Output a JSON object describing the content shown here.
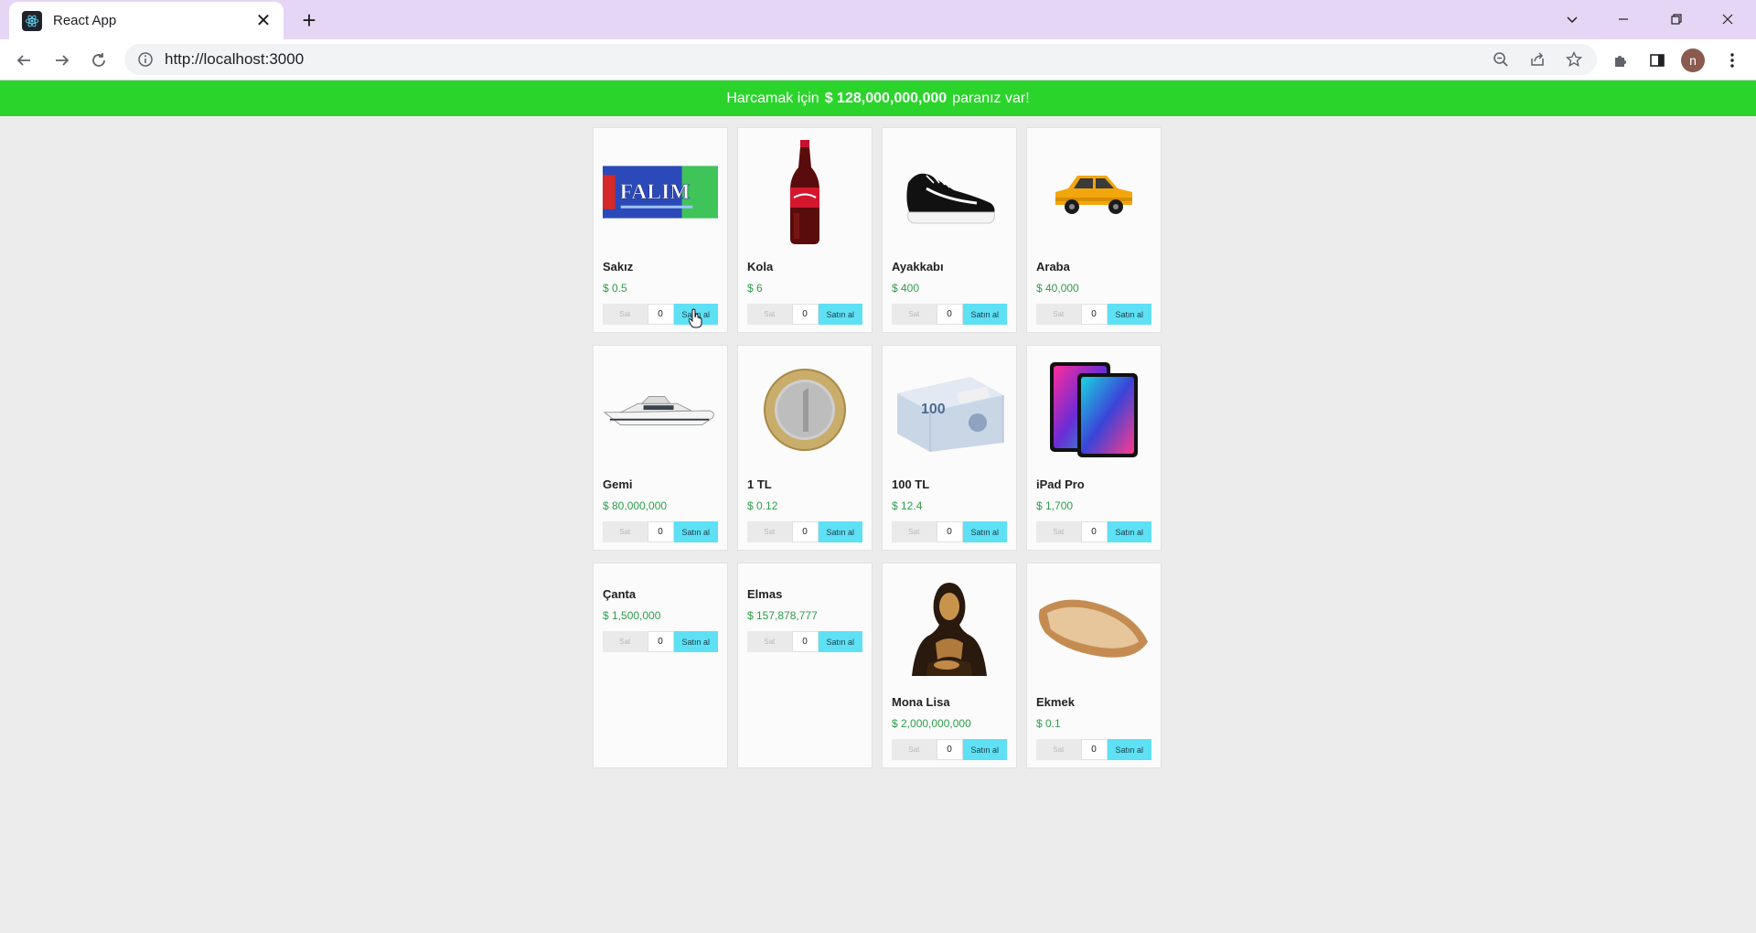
{
  "browser": {
    "tab_title": "React App",
    "url": "http://localhost:3000",
    "profile_initial": "n"
  },
  "banner": {
    "prefix": "Harcamak için",
    "amount": "$ 128,000,000,000",
    "suffix": "paranız var!"
  },
  "products": [
    {
      "name": "Sakız",
      "price": "$ 0.5",
      "icon": "gum-image",
      "sell_label": "Sat",
      "qty": "0",
      "buy_label": "Satın al"
    },
    {
      "name": "Kola",
      "price": "$ 6",
      "icon": "cola-bottle-image",
      "sell_label": "Sat",
      "qty": "0",
      "buy_label": "Satın al"
    },
    {
      "name": "Ayakkabı",
      "price": "$ 400",
      "icon": "sneaker-image",
      "sell_label": "Sat",
      "qty": "0",
      "buy_label": "Satın al"
    },
    {
      "name": "Araba",
      "price": "$ 40,000",
      "icon": "car-image",
      "sell_label": "Sat",
      "qty": "0",
      "buy_label": "Satın al"
    },
    {
      "name": "Gemi",
      "price": "$ 80,000,000",
      "icon": "yacht-image",
      "sell_label": "Sat",
      "qty": "0",
      "buy_label": "Satın al"
    },
    {
      "name": "1 TL",
      "price": "$ 0.12",
      "icon": "coin-image",
      "sell_label": "Sat",
      "qty": "0",
      "buy_label": "Satın al"
    },
    {
      "name": "100 TL",
      "price": "$ 12.4",
      "icon": "banknotes-image",
      "sell_label": "Sat",
      "qty": "0",
      "buy_label": "Satın al"
    },
    {
      "name": "iPad Pro",
      "price": "$ 1,700",
      "icon": "tablet-image",
      "sell_label": "Sat",
      "qty": "0",
      "buy_label": "Satın al"
    },
    {
      "name": "Çanta",
      "price": "$ 1,500,000",
      "icon": "",
      "sell_label": "Sat",
      "qty": "0",
      "buy_label": "Satın al"
    },
    {
      "name": "Elmas",
      "price": "$ 157,878,777",
      "icon": "",
      "sell_label": "Sat",
      "qty": "0",
      "buy_label": "Satın al"
    },
    {
      "name": "Mona Lisa",
      "price": "$ 2,000,000,000",
      "icon": "painting-image",
      "sell_label": "Sat",
      "qty": "0",
      "buy_label": "Satın al"
    },
    {
      "name": "Ekmek",
      "price": "$ 0.1",
      "icon": "bread-image",
      "sell_label": "Sat",
      "qty": "0",
      "buy_label": "Satın al"
    }
  ],
  "colors": {
    "banner": "#2bd42b",
    "price": "#2e9d4a",
    "buy_button": "#5ee0f5",
    "tabbar": "#e6d6f5"
  }
}
